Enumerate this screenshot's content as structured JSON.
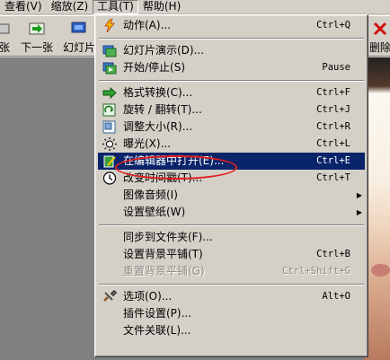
{
  "menubar": {
    "view": "查看(V)",
    "zoom": "缩放(Z)",
    "tools": "工具(T)",
    "help": "帮助(H)"
  },
  "toolbar": {
    "cut_label": "张",
    "next": "下一张",
    "slide": "幻灯片",
    "delete": "删除"
  },
  "menu": {
    "g1": [
      {
        "label": "动作(A)...",
        "shortcut": "Ctrl+Q",
        "icon": "lightning-icon"
      }
    ],
    "g2": [
      {
        "label": "幻灯片演示(D)...",
        "shortcut": "",
        "icon": "slideshow-icon"
      },
      {
        "label": "开始/停止(S)",
        "shortcut": "Pause",
        "icon": "slideshow-startstop-icon"
      }
    ],
    "g3": [
      {
        "label": "格式转换(C)...",
        "shortcut": "Ctrl+F",
        "icon": "convert-icon"
      },
      {
        "label": "旋转 / 翻转(T)...",
        "shortcut": "Ctrl+J",
        "icon": "rotate-icon"
      },
      {
        "label": "调整大小(R)...",
        "shortcut": "Ctrl+R",
        "icon": "resize-icon"
      },
      {
        "label": "曝光(X)...",
        "shortcut": "Ctrl+L",
        "icon": "exposure-icon"
      },
      {
        "label": "在编辑器中打开(E)...",
        "shortcut": "Ctrl+E",
        "icon": "edit-icon",
        "selected": true
      },
      {
        "label": "改变时间戳(T)...",
        "shortcut": "Ctrl+T",
        "icon": "clock-icon"
      },
      {
        "label": "图像音频(I)",
        "shortcut": "",
        "submenu": true
      },
      {
        "label": "设置壁纸(W)",
        "shortcut": "",
        "submenu": true
      }
    ],
    "g4": [
      {
        "label": "同步到文件夹(F)...",
        "shortcut": ""
      },
      {
        "label": "设置背景平铺(T)",
        "shortcut": "Ctrl+B"
      },
      {
        "label": "重置背景平铺(G)",
        "shortcut": "Ctrl+Shift+G",
        "disabled": true
      }
    ],
    "g5": [
      {
        "label": "选项(O)...",
        "shortcut": "Alt+O",
        "icon": "options-icon"
      },
      {
        "label": "插件设置(P)...",
        "shortcut": ""
      },
      {
        "label": "文件关联(L)...",
        "shortcut": ""
      }
    ]
  },
  "colors": {
    "highlight": "#0a246a",
    "annotation": "#e02020",
    "chrome": "#d4d0c8"
  }
}
